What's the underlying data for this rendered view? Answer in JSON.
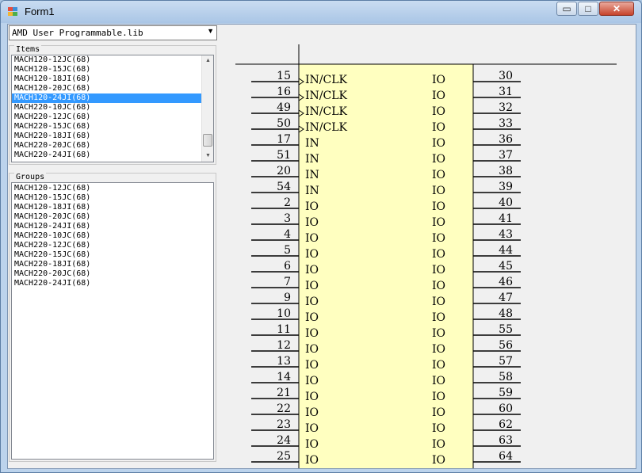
{
  "window": {
    "title": "Form1",
    "minimize_glyph": "▭",
    "maximize_glyph": "□",
    "close_glyph": "✕"
  },
  "library_combo": {
    "value": "AMD User Programmable.lib",
    "arrow_glyph": "▼"
  },
  "items_group": {
    "label": "Items",
    "items": [
      "MACH120-12JC(68)",
      "MACH120-15JC(68)",
      "MACH120-18JI(68)",
      "MACH120-20JC(68)",
      "MACH120-24JI(68)",
      "MACH220-10JC(68)",
      "MACH220-12JC(68)",
      "MACH220-15JC(68)",
      "MACH220-18JI(68)",
      "MACH220-20JC(68)",
      "MACH220-24JI(68)"
    ],
    "selected_index": 4,
    "scroll_up_glyph": "▲",
    "scroll_down_glyph": "▼"
  },
  "groups_group": {
    "label": "Groups",
    "items": [
      "MACH120-12JC(68)",
      "MACH120-15JC(68)",
      "MACH120-18JI(68)",
      "MACH120-20JC(68)",
      "MACH120-24JI(68)",
      "MACH220-10JC(68)",
      "MACH220-12JC(68)",
      "MACH220-15JC(68)",
      "MACH220-18JI(68)",
      "MACH220-20JC(68)",
      "MACH220-24JI(68)"
    ]
  },
  "symbol": {
    "left_pins": [
      {
        "num": "15",
        "name": "IN/CLK",
        "clock": true
      },
      {
        "num": "16",
        "name": "IN/CLK",
        "clock": true
      },
      {
        "num": "49",
        "name": "IN/CLK",
        "clock": true
      },
      {
        "num": "50",
        "name": "IN/CLK",
        "clock": true
      },
      {
        "num": "17",
        "name": "IN"
      },
      {
        "num": "51",
        "name": "IN"
      },
      {
        "num": "20",
        "name": "IN"
      },
      {
        "num": "54",
        "name": "IN"
      },
      {
        "num": "2",
        "name": "IO"
      },
      {
        "num": "3",
        "name": "IO"
      },
      {
        "num": "4",
        "name": "IO"
      },
      {
        "num": "5",
        "name": "IO"
      },
      {
        "num": "6",
        "name": "IO"
      },
      {
        "num": "7",
        "name": "IO"
      },
      {
        "num": "9",
        "name": "IO"
      },
      {
        "num": "10",
        "name": "IO"
      },
      {
        "num": "11",
        "name": "IO"
      },
      {
        "num": "12",
        "name": "IO"
      },
      {
        "num": "13",
        "name": "IO"
      },
      {
        "num": "14",
        "name": "IO"
      },
      {
        "num": "21",
        "name": "IO"
      },
      {
        "num": "22",
        "name": "IO"
      },
      {
        "num": "23",
        "name": "IO"
      },
      {
        "num": "24",
        "name": "IO"
      },
      {
        "num": "25",
        "name": "IO"
      }
    ],
    "right_pins": [
      {
        "num": "30",
        "name": "IO"
      },
      {
        "num": "31",
        "name": "IO"
      },
      {
        "num": "32",
        "name": "IO"
      },
      {
        "num": "33",
        "name": "IO"
      },
      {
        "num": "36",
        "name": "IO"
      },
      {
        "num": "37",
        "name": "IO"
      },
      {
        "num": "38",
        "name": "IO"
      },
      {
        "num": "39",
        "name": "IO"
      },
      {
        "num": "40",
        "name": "IO"
      },
      {
        "num": "41",
        "name": "IO"
      },
      {
        "num": "43",
        "name": "IO"
      },
      {
        "num": "44",
        "name": "IO"
      },
      {
        "num": "45",
        "name": "IO"
      },
      {
        "num": "46",
        "name": "IO"
      },
      {
        "num": "47",
        "name": "IO"
      },
      {
        "num": "48",
        "name": "IO"
      },
      {
        "num": "55",
        "name": "IO"
      },
      {
        "num": "56",
        "name": "IO"
      },
      {
        "num": "57",
        "name": "IO"
      },
      {
        "num": "58",
        "name": "IO"
      },
      {
        "num": "59",
        "name": "IO"
      },
      {
        "num": "60",
        "name": "IO"
      },
      {
        "num": "62",
        "name": "IO"
      },
      {
        "num": "63",
        "name": "IO"
      },
      {
        "num": "64",
        "name": "IO"
      }
    ],
    "body_color": "#ffffc0"
  }
}
